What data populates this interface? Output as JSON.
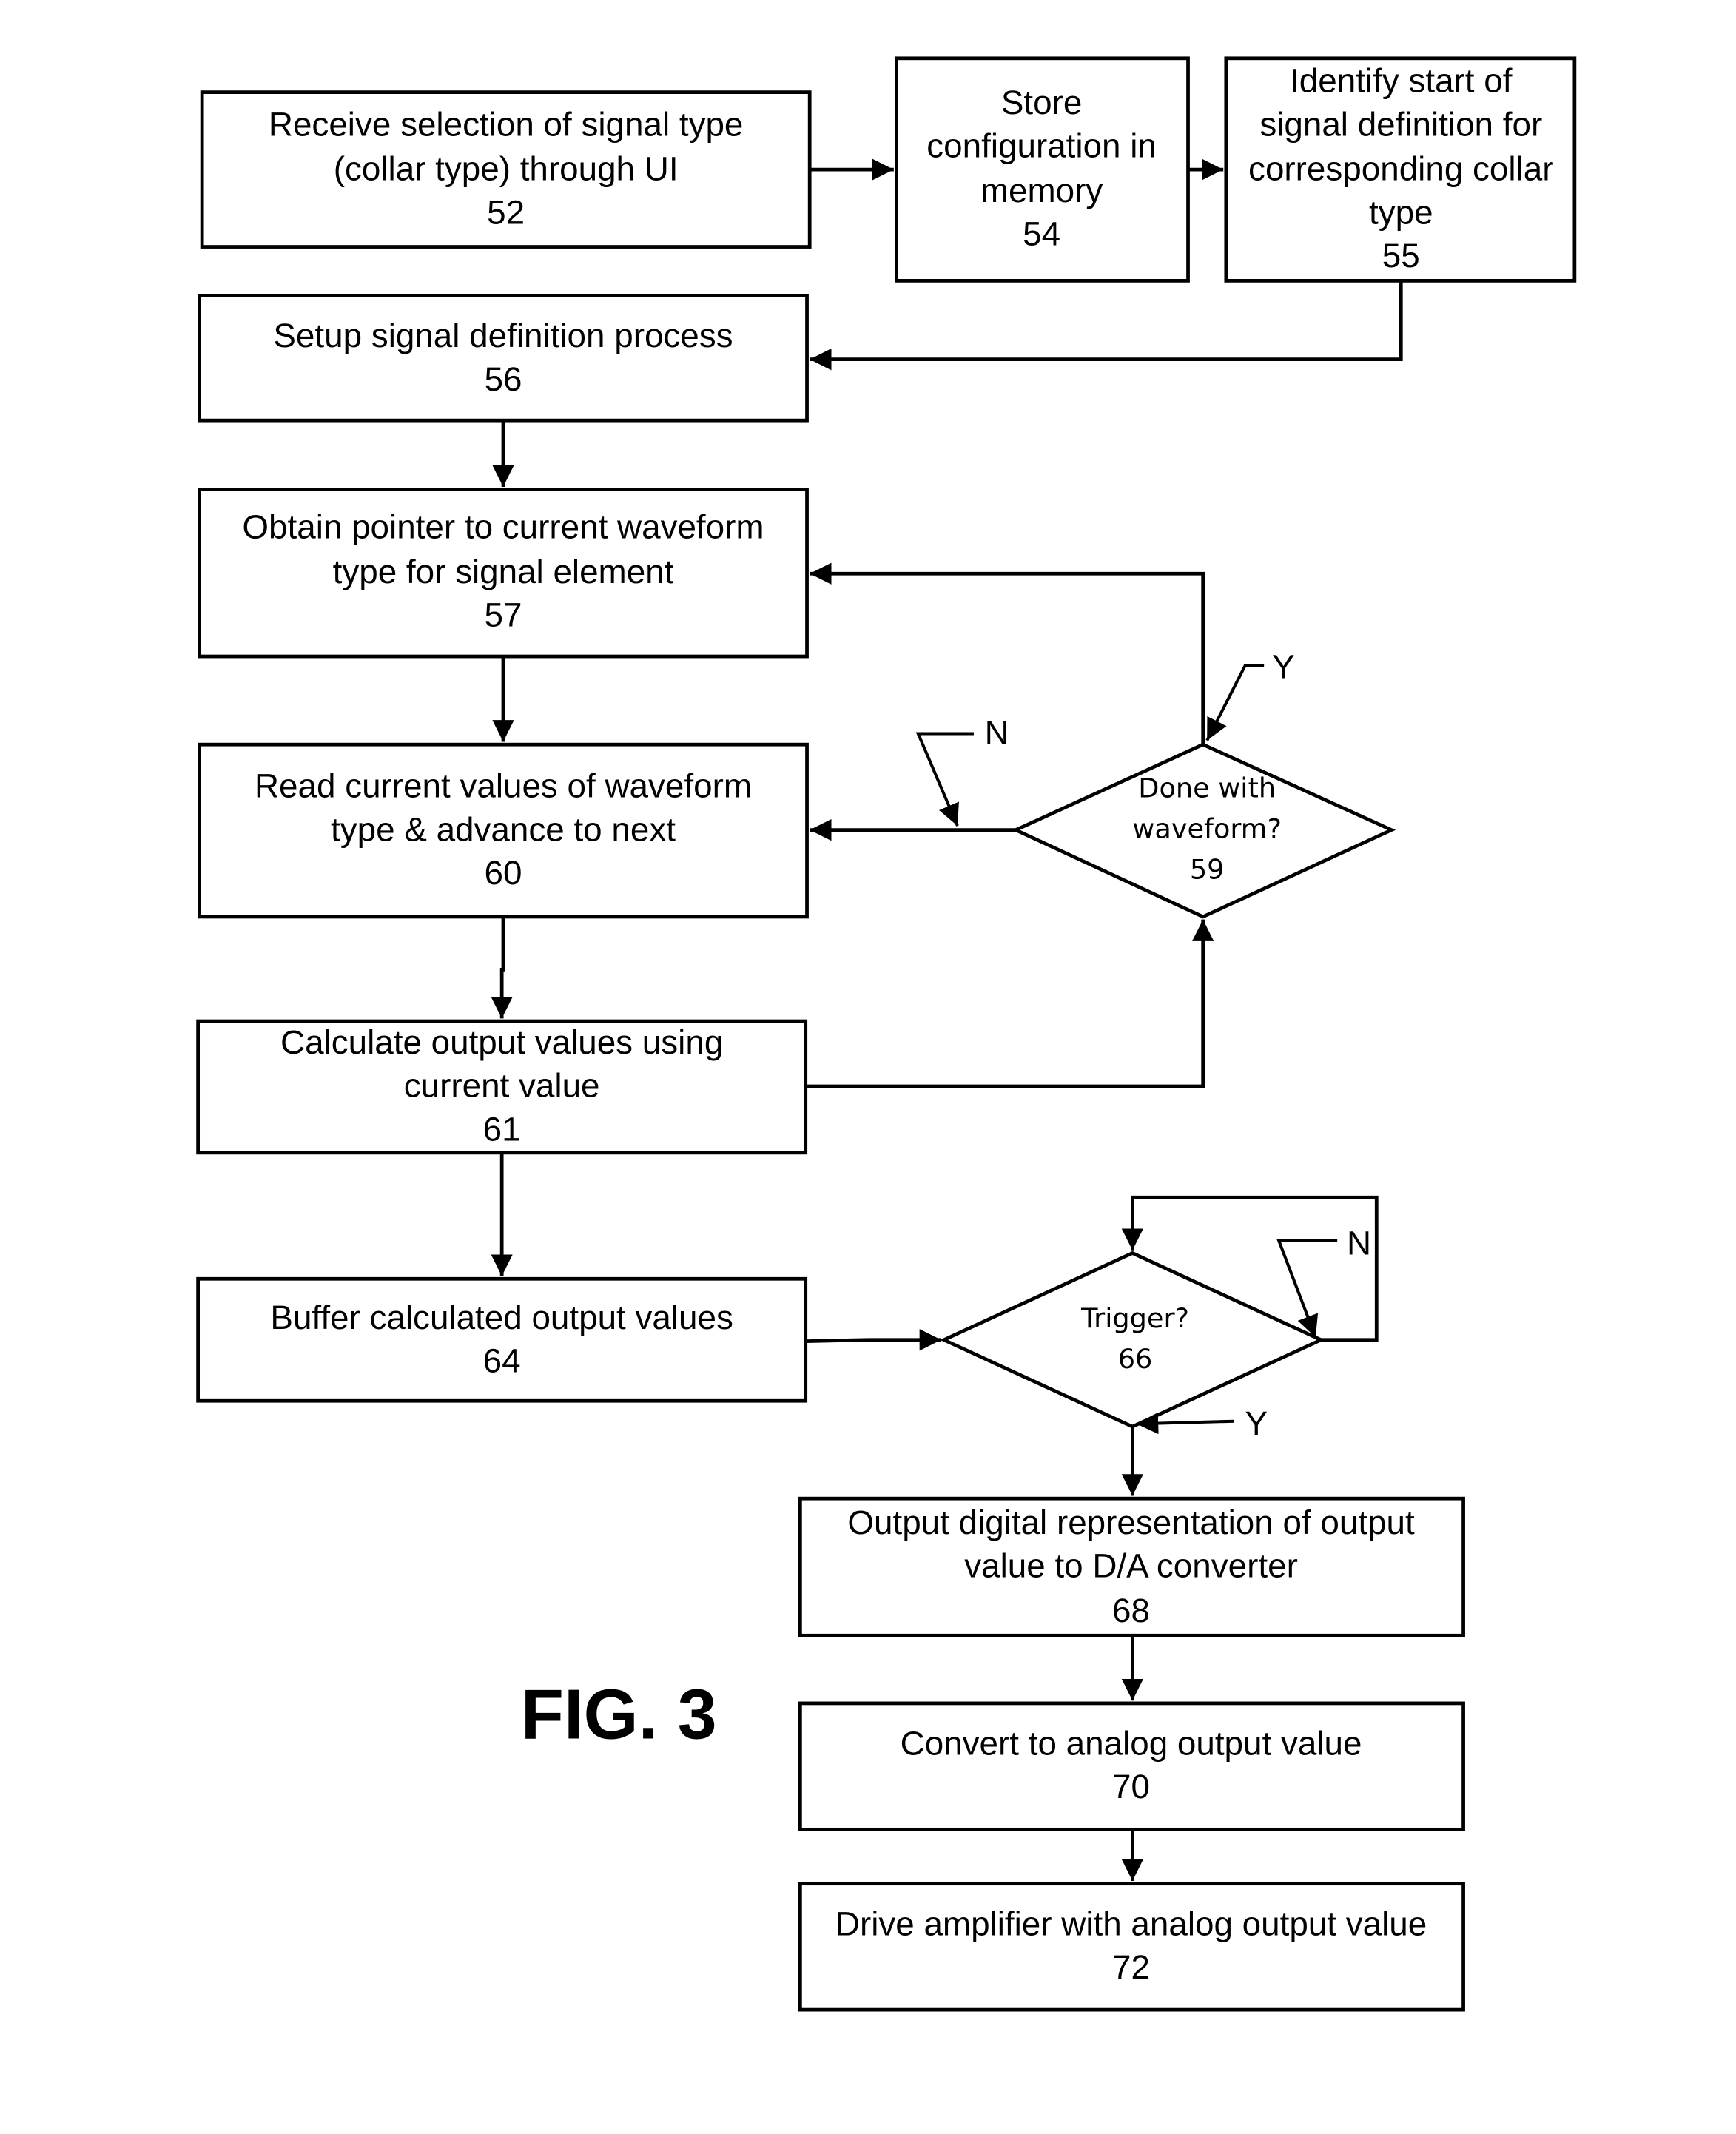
{
  "figure": {
    "title": "FIG. 3"
  },
  "steps": {
    "s52": {
      "lines": [
        "Receive selection of signal type",
        "(collar type) through UI"
      ],
      "ref": "52"
    },
    "s54": {
      "lines": [
        "Store",
        "configuration in",
        "memory"
      ],
      "ref": "54"
    },
    "s55": {
      "lines": [
        "Identify start of",
        "signal definition for",
        "corresponding collar",
        "type"
      ],
      "ref": "55"
    },
    "s56": {
      "lines": [
        "Setup signal definition process"
      ],
      "ref": "56"
    },
    "s57": {
      "lines": [
        "Obtain pointer to current waveform",
        "type for signal element"
      ],
      "ref": "57"
    },
    "s60": {
      "lines": [
        "Read current values of waveform",
        "type & advance to next"
      ],
      "ref": "60"
    },
    "s61": {
      "lines": [
        "Calculate output values using",
        "current value"
      ],
      "ref": "61"
    },
    "s64": {
      "lines": [
        "Buffer calculated output values"
      ],
      "ref": "64"
    },
    "s68": {
      "lines": [
        "Output digital representation of output",
        "value to D/A converter"
      ],
      "ref": "68"
    },
    "s70": {
      "lines": [
        "Convert to analog output value"
      ],
      "ref": "70"
    },
    "s72": {
      "lines": [
        "Drive amplifier with analog output value"
      ],
      "ref": "72"
    }
  },
  "decisions": {
    "d59": {
      "lines": [
        "Done with",
        "waveform?"
      ],
      "ref": "59",
      "yes_label": "Y",
      "no_label": "N"
    },
    "d66": {
      "lines": [
        "Trigger?"
      ],
      "ref": "66",
      "yes_label": "Y",
      "no_label": "N"
    }
  }
}
